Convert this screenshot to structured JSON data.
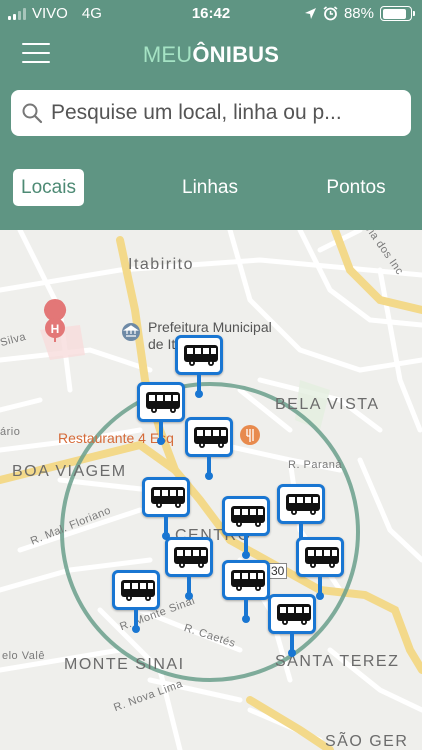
{
  "status": {
    "carrier": "VIVO",
    "network": "4G",
    "time": "16:42",
    "battery": "88%",
    "battery_level": 0.88
  },
  "header": {
    "logo_part1": "MEU",
    "logo_part2": "ÔNIBUS"
  },
  "search": {
    "placeholder": "Pesquise um local, linha ou p..."
  },
  "tabs": [
    {
      "label": "Locais",
      "active": true
    },
    {
      "label": "Linhas",
      "active": false
    },
    {
      "label": "Pontos",
      "active": false
    }
  ],
  "map": {
    "labels": {
      "itabirito": "Itabirito",
      "prefeitura_1": "Prefeitura Municipal",
      "prefeitura_2": "de Itabirito",
      "bela_vista": "BELA VISTA",
      "restaurante": "Restaurante 4 Esq",
      "boa_viagem": "BOA VIAGEM",
      "centro": "CENTRO",
      "monte_sinai": "MONTE SINAI",
      "santa_terez": "SANTA TEREZ",
      "sao_ger": "SÃO GER",
      "r_parana": "R. Paraná",
      "r_mal_floriano": "R. Mal. Floriano",
      "r_monte_sinai": "R. Monte Sinai",
      "r_caetes": "R. Caetés",
      "r_nova_lima": "R. Nova Lima",
      "belo_vale": "elo Valê",
      "silva": "Silva",
      "ario": "ário",
      "via_dos": "via dos Inc",
      "road_30": "30"
    },
    "accent_color": "#1976d2",
    "primary_color": "#5f9583"
  }
}
